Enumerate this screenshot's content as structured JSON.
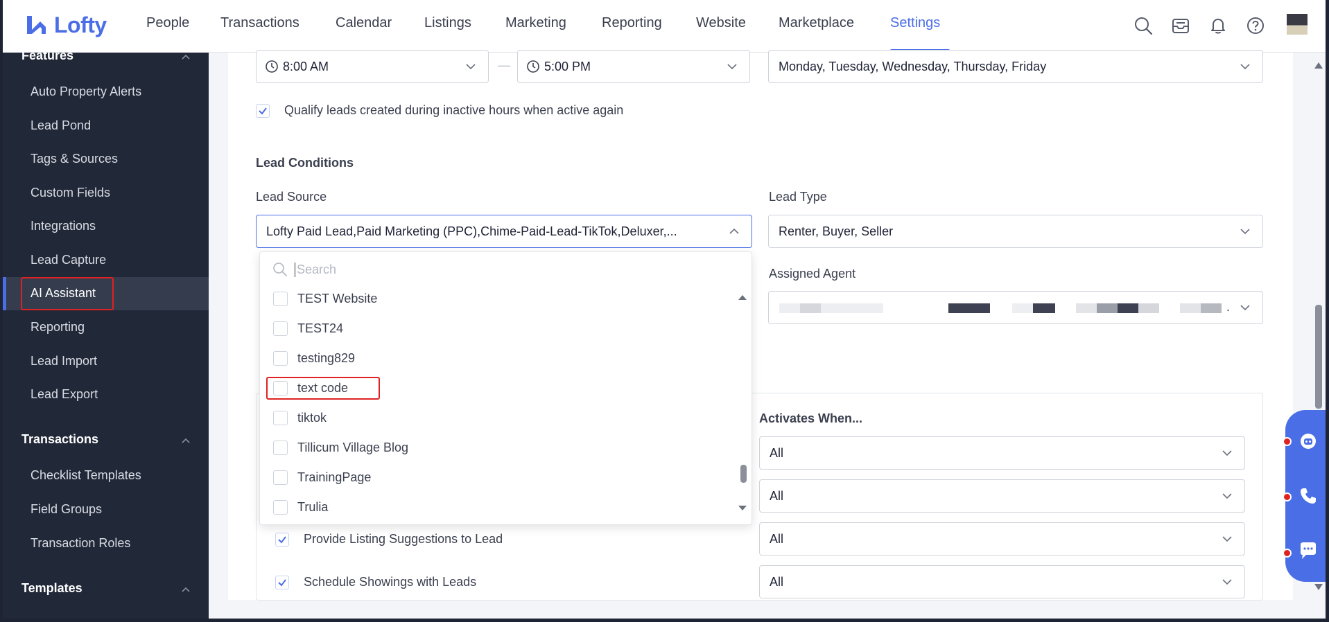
{
  "brand": {
    "name": "Lofty",
    "color": "#4a6ee6"
  },
  "nav": {
    "items": [
      "People",
      "Transactions",
      "Calendar",
      "Listings",
      "Marketing",
      "Reporting",
      "Website",
      "Marketplace",
      "Settings"
    ],
    "active": "Settings",
    "icons": [
      "search-icon",
      "inbox-icon",
      "bell-icon",
      "help-icon"
    ]
  },
  "sidebar": {
    "features_title": "Features",
    "features": [
      "Auto Property Alerts",
      "Lead Pond",
      "Tags & Sources",
      "Custom Fields",
      "Integrations",
      "Lead Capture",
      "AI Assistant",
      "Reporting",
      "Lead Import",
      "Lead Export"
    ],
    "active_item": "AI Assistant",
    "transactions_title": "Transactions",
    "transactions": [
      "Checklist Templates",
      "Field Groups",
      "Transaction Roles"
    ],
    "templates_title": "Templates"
  },
  "hours": {
    "start": "8:00 AM",
    "dash": "—",
    "end": "5:00 PM",
    "days": "Monday, Tuesday, Wednesday, Thursday, Friday"
  },
  "qualify_inactive": {
    "label": "Qualify leads created during inactive hours when active again",
    "checked": true
  },
  "lead_conditions": {
    "title": "Lead Conditions",
    "lead_source_label": "Lead Source",
    "lead_source_value": "Lofty Paid Lead,Paid Marketing (PPC),Chime-Paid-Lead-TikTok,Deluxer,...",
    "lead_type_label": "Lead Type",
    "lead_type_value": "Renter, Buyer, Seller",
    "assigned_agent_label": "Assigned Agent",
    "assigned_agent_ellipsis": "."
  },
  "dropdown": {
    "search_placeholder": "Search",
    "options": [
      {
        "label": "TEST Website",
        "checked": false
      },
      {
        "label": "TEST24",
        "checked": false
      },
      {
        "label": "testing829",
        "checked": false
      },
      {
        "label": "text code",
        "checked": false
      },
      {
        "label": "tiktok",
        "checked": false
      },
      {
        "label": "Tillicum Village Blog",
        "checked": false
      },
      {
        "label": "TrainingPage",
        "checked": false
      },
      {
        "label": "Trulia",
        "checked": false
      }
    ]
  },
  "tasks": {
    "activates_when_label": "Activates When...",
    "rows": [
      {
        "label": "",
        "value": "All",
        "checked": true
      },
      {
        "label": "",
        "value": "All",
        "checked": true
      },
      {
        "label": "Provide Listing Suggestions to Lead",
        "value": "All",
        "checked": true
      },
      {
        "label": "Schedule Showings with Leads",
        "value": "All",
        "checked": true
      }
    ]
  },
  "widget": {
    "icons": [
      "chatbot-icon",
      "phone-icon",
      "chat-bubble-icon"
    ]
  }
}
